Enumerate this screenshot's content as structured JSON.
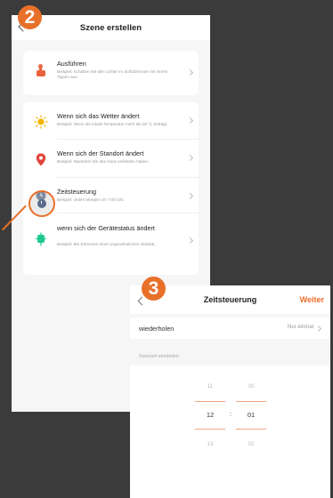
{
  "badges": {
    "step1": "2",
    "step2": "3"
  },
  "screen1": {
    "title": "Szene erstellen",
    "items": [
      {
        "icon": "tap-hand-icon",
        "title": "Ausführen",
        "subtitle": "Beispiel: Schalten Sie alle Lichter im Schlafzimmer mit einem Tippen aus."
      },
      {
        "icon": "sun-icon",
        "title": "Wenn sich das Wetter ändert",
        "subtitle": "Beispiel: Wenn die lokale Temperatur mehr als 28 °C beträgt."
      },
      {
        "icon": "location-pin-icon",
        "title": "Wenn sich der Standort ändert",
        "subtitle": "Beispiel: Nachdem Sie das Haus verlassen haben."
      },
      {
        "icon": "clock-icon",
        "title": "Zeitsteuerung",
        "subtitle": "Beispiel: Jeden Morgen um 7:00 Uhr."
      },
      {
        "icon": "device-icon",
        "title": "wenn sich der Gerätestatus ändert",
        "subtitle": "Beispiel: Bei Erkennen einer ungewöhnlichen Aktivität."
      }
    ],
    "colors": {
      "tap": "#e8643c",
      "sun": "#f5b400",
      "location": "#e2453c",
      "clock": "#5a6d8c",
      "device": "#1fc98e"
    }
  },
  "screen2": {
    "title": "Zeitsteuerung",
    "next_label": "Weiter",
    "repeat_label": "wiederholen",
    "repeat_value": "Nur einmal",
    "section_label": "Startzeit einstellen",
    "hours": [
      "11",
      "12",
      "13"
    ],
    "minutes": [
      "00",
      "01",
      "02"
    ],
    "selected_hour": "12",
    "selected_minute": "01",
    "accent_color": "#f06a2a"
  }
}
